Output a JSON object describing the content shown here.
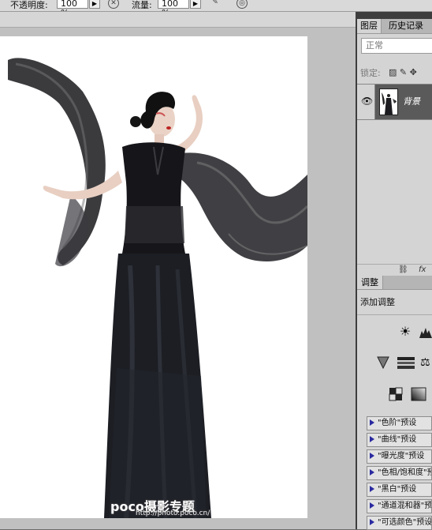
{
  "options_bar": {
    "opacity_label": "不透明度:",
    "opacity_value": "100 %",
    "flow_label": "流量:",
    "flow_value": "100 %"
  },
  "layers_panel": {
    "tabs": [
      "图层",
      "历史记录"
    ],
    "blend_mode": "正常",
    "lock_label": "锁定:",
    "layer": {
      "name": "背景"
    },
    "footer_icons": [
      "link-icon",
      "fx-icon"
    ],
    "footer_fx": "fx"
  },
  "adjustments_panel": {
    "tab": "调整",
    "title": "添加调整",
    "presets": [
      "\"色阶\"预设",
      "\"曲线\"预设",
      "\"曝光度\"预设",
      "\"色相/饱和度\"预设",
      "\"黑白\"预设",
      "\"通道混和器\"预设",
      "\"可选颜色\"预设"
    ]
  },
  "watermark": {
    "brand": "poco摄影专题",
    "url": "http://photo.poco.cn/"
  }
}
